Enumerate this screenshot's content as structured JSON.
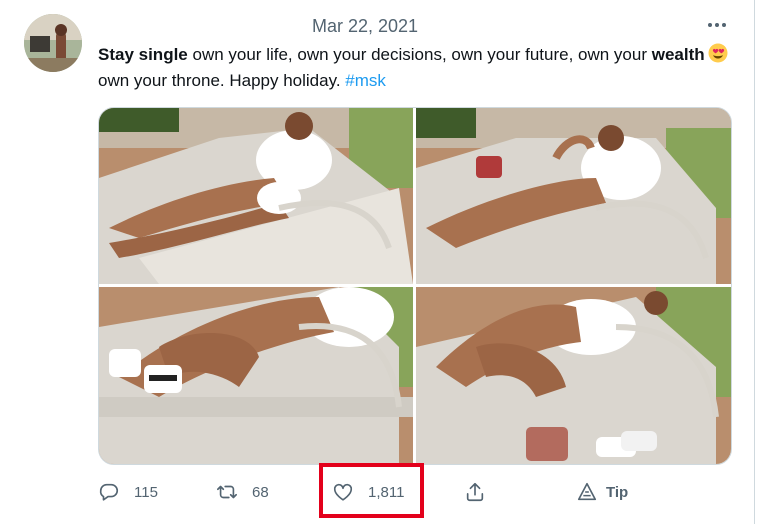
{
  "tweet": {
    "date": "Mar 22, 2021",
    "text": {
      "bold_start": "Stay single",
      "part1": " own your life, own your decisions,  own your future,  own your ",
      "bold_mid": "wealth",
      "emoji": "heart-eyes-emoji",
      "part2": " own your throne. Happy holiday. ",
      "hashtag": "#msk"
    },
    "photos": [
      "photo-1",
      "photo-2",
      "photo-3",
      "photo-4"
    ]
  },
  "actions": {
    "reply_count": "115",
    "retweet_count": "68",
    "like_count": "1,811",
    "tip_label": "Tip"
  },
  "icons": [
    "more-icon",
    "reply-icon",
    "retweet-icon",
    "like-icon",
    "share-icon",
    "tip-icon"
  ],
  "colors": {
    "accent": "#1d9bf0",
    "muted": "#536471",
    "highlight": "#e3001b"
  }
}
